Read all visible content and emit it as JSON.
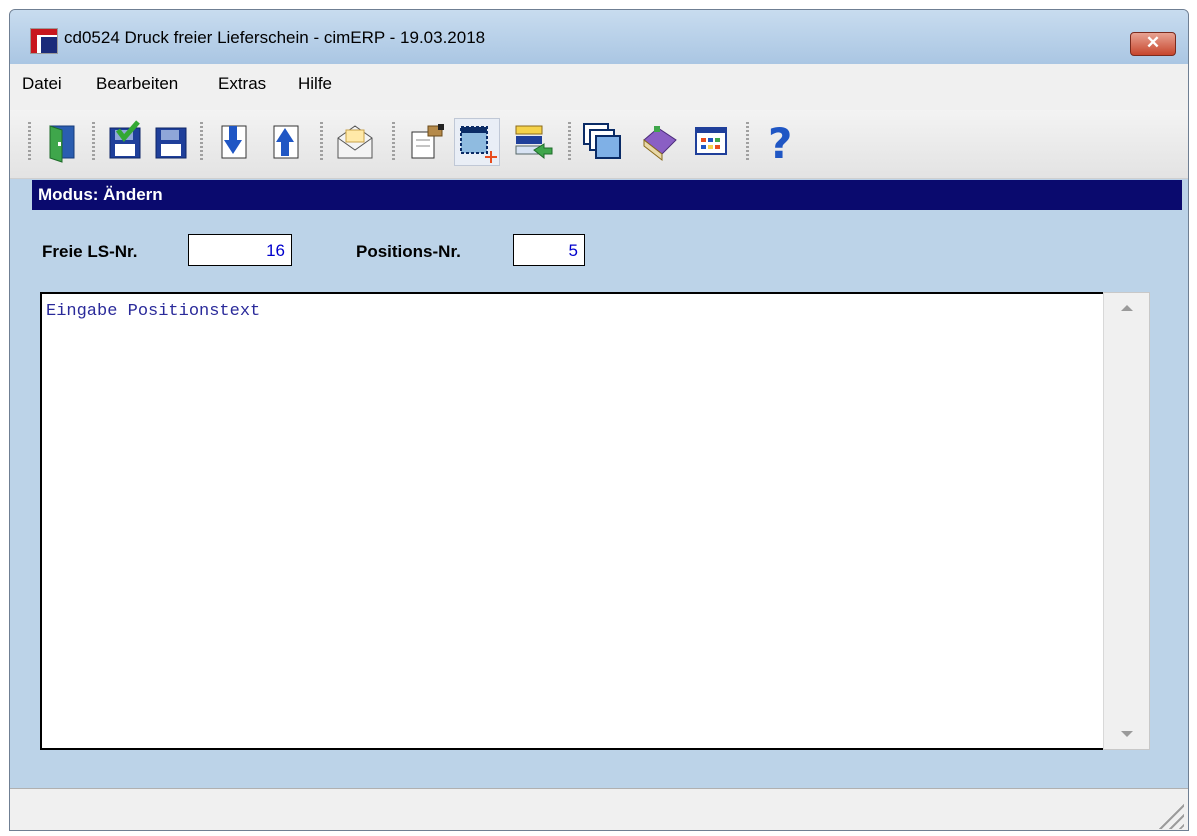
{
  "window": {
    "title": "cd0524 Druck freier Lieferschein - cimERP - 19.03.2018",
    "close_label": "✕"
  },
  "menu": {
    "items": [
      "Datei",
      "Bearbeiten",
      "Extras",
      "Hilfe"
    ]
  },
  "toolbar": {
    "buttons": [
      {
        "icon": "exit-door-icon"
      },
      {
        "icon": "save-check-icon"
      },
      {
        "icon": "save-icon"
      },
      {
        "icon": "arrow-down-doc-icon"
      },
      {
        "icon": "arrow-up-doc-icon"
      },
      {
        "icon": "envelope-icon"
      },
      {
        "icon": "print-preview-icon"
      },
      {
        "icon": "new-window-icon"
      },
      {
        "icon": "transfer-list-icon"
      },
      {
        "icon": "windows-cascade-icon"
      },
      {
        "icon": "book-icon"
      },
      {
        "icon": "grid-table-icon"
      },
      {
        "icon": "help-icon"
      }
    ]
  },
  "mode": {
    "label": "Modus: Ändern"
  },
  "form": {
    "ls_label": "Freie LS-Nr.",
    "ls_value": "16",
    "pos_label": "Positions-Nr.",
    "pos_value": "5",
    "text_value": "Eingabe Positionstext"
  },
  "colors": {
    "accent": "#0a0a6e",
    "background": "#bcd3e8",
    "field_text": "#0000cc"
  }
}
